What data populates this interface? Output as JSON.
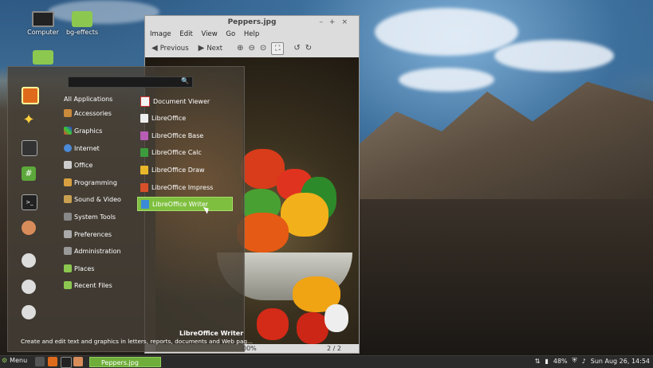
{
  "desktop": {
    "icons": [
      {
        "label": "Computer"
      },
      {
        "label": "bg-effects"
      }
    ]
  },
  "viewer": {
    "title": "Peppers.jpg",
    "menu": [
      "Image",
      "Edit",
      "View",
      "Go",
      "Help"
    ],
    "toolbar": {
      "previous": "Previous",
      "next": "Next"
    },
    "status": {
      "zoom": "00%",
      "page": "2 / 2"
    }
  },
  "start_menu": {
    "search_value": "",
    "categories": [
      "All Applications",
      "Accessories",
      "Graphics",
      "Internet",
      "Office",
      "Programming",
      "Sound & Video",
      "System Tools",
      "Preferences",
      "Administration",
      "Places",
      "Recent Files"
    ],
    "apps": [
      "Document Viewer",
      "LibreOffice",
      "LibreOffice Base",
      "LibreOffice Calc",
      "LibreOffice Draw",
      "LibreOffice Impress",
      "LibreOffice Writer"
    ],
    "selected_title": "LibreOffice Writer",
    "selected_description": "Create and edit text and graphics in letters, reports, documents and Web pag..."
  },
  "panel": {
    "menu_label": "Menu",
    "task_label": "Peppers.jpg",
    "battery": "48%",
    "clock": "Sun Aug 26, 14:54"
  },
  "colors": {
    "accent": "#7fbf3f",
    "panel": "#2b2b2b"
  }
}
